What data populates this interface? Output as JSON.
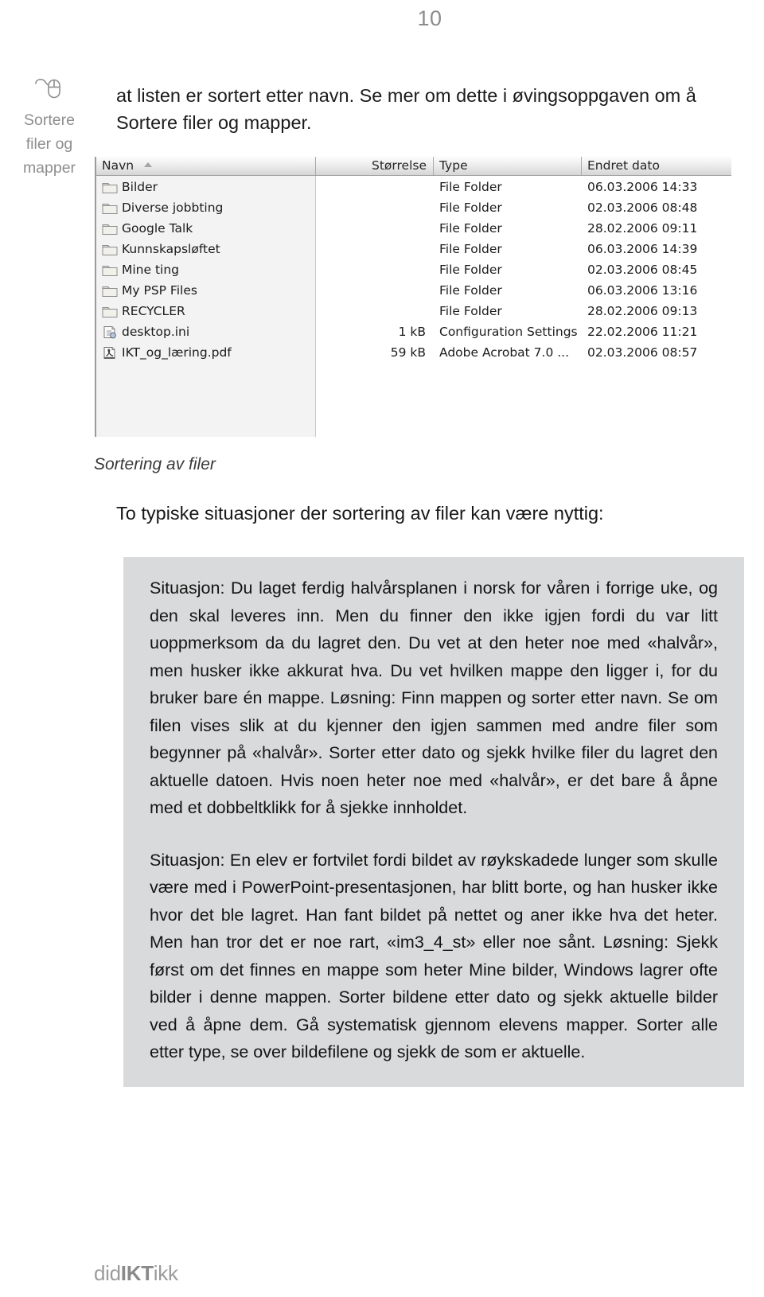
{
  "page": {
    "number": "10",
    "footer_logo_pre": "did",
    "footer_logo_mid": "IKT",
    "footer_logo_post": "ikk"
  },
  "margin_note": {
    "icon": "mouse-icon",
    "line1": "Sortere",
    "line2": "filer og",
    "line3": "mapper"
  },
  "intro": {
    "text": "at listen er sortert etter navn. Se mer om dette i øvingsoppgaven om å Sortere filer og mapper."
  },
  "explorer": {
    "columns": {
      "name": "Navn",
      "size": "Størrelse",
      "type": "Type",
      "date": "Endret dato"
    },
    "sort": {
      "column": "Navn",
      "direction": "ascending",
      "icon": "sort-ascending-arrow-icon"
    },
    "rows": [
      {
        "icon": "folder-icon",
        "name": "Bilder",
        "size": "",
        "type": "File Folder",
        "date": "06.03.2006 14:33"
      },
      {
        "icon": "folder-icon",
        "name": "Diverse jobbting",
        "size": "",
        "type": "File Folder",
        "date": "02.03.2006 08:48"
      },
      {
        "icon": "folder-icon",
        "name": "Google Talk",
        "size": "",
        "type": "File Folder",
        "date": "28.02.2006 09:11"
      },
      {
        "icon": "folder-icon",
        "name": "Kunnskapsløftet",
        "size": "",
        "type": "File Folder",
        "date": "06.03.2006 14:39"
      },
      {
        "icon": "folder-icon",
        "name": "Mine ting",
        "size": "",
        "type": "File Folder",
        "date": "02.03.2006 08:45"
      },
      {
        "icon": "folder-icon",
        "name": "My PSP Files",
        "size": "",
        "type": "File Folder",
        "date": "06.03.2006 13:16"
      },
      {
        "icon": "folder-icon",
        "name": "RECYCLER",
        "size": "",
        "type": "File Folder",
        "date": "28.02.2006 09:13"
      },
      {
        "icon": "ini-file-icon",
        "name": "desktop.ini",
        "size": "1 kB",
        "type": "Configuration Settings",
        "date": "22.02.2006 11:21"
      },
      {
        "icon": "pdf-file-icon",
        "name": "IKT_og_læring.pdf",
        "size": "59 kB",
        "type": "Adobe Acrobat 7.0 ...",
        "date": "02.03.2006 08:57"
      }
    ]
  },
  "figure_caption": "Sortering av filer",
  "lead": "To typiske situasjoner der sortering av filer kan være nyttig:",
  "situations": [
    "Situasjon: Du laget ferdig halvårsplanen i norsk for våren i forrige uke, og den skal leveres inn. Men du finner den ikke igjen fordi du var litt uoppmerksom da du lagret den. Du vet at den heter noe med «halvår», men husker ikke akkurat hva. Du vet hvilken mappe den ligger i, for du bruker bare én mappe. Løsning: Finn mappen og sorter etter navn. Se om filen vises slik at du kjenner den igjen sammen med andre filer som begynner på «halvår». Sorter etter dato og sjekk hvilke filer du lagret den aktuelle datoen. Hvis noen heter noe med «halvår», er det bare å åpne med et dobbeltklikk for å sjekke innholdet.",
    "Situasjon: En elev er fortvilet fordi bildet av røykskadede lunger som skulle være med i PowerPoint-presentasjonen, har blitt borte, og han husker ikke hvor det ble lagret. Han fant bildet på nettet og aner ikke hva det heter. Men han tror det er noe rart, «im3_4_st» eller noe sånt. Løsning: Sjekk først om det finnes en mappe som heter Mine bilder, Windows lagrer ofte bilder i denne mappen. Sorter bildene etter dato og sjekk aktuelle bilder ved å åpne dem. Gå systematisk gjennom elevens mapper. Sorter alle etter type, se over bildefilene og sjekk de som er aktuelle."
  ],
  "colors": {
    "gray_block": "#d9dadb",
    "page_number": "#8c8c8c",
    "margin_note": "#8e8e8e"
  }
}
